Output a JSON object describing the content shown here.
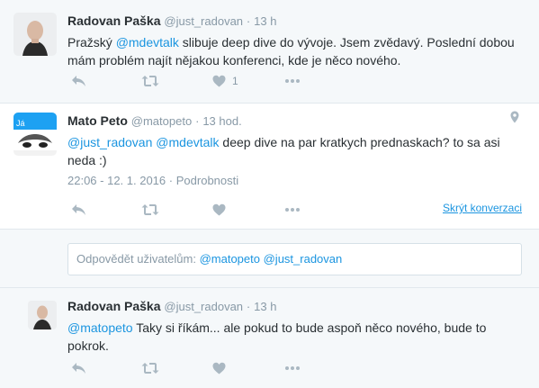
{
  "tweets": [
    {
      "name": "Radovan Paška",
      "handle": "@just_radovan",
      "dot": "·",
      "time": "13 h",
      "text_parts": [
        {
          "text": "Pražský ",
          "mention": false
        },
        {
          "text": "@mdevtalk",
          "mention": true
        },
        {
          "text": " slibuje deep dive do vývoje. Jsem zvědavý. Poslední dobou mám problém najít nějakou konferenci, kde je něco nového.",
          "mention": false
        }
      ],
      "like_count": "1"
    },
    {
      "name": "Mato Peto",
      "handle": "@matopeto",
      "dot": "·",
      "time": "13 hod.",
      "text_parts": [
        {
          "text": "@just_radovan",
          "mention": true
        },
        {
          "text": " ",
          "mention": false
        },
        {
          "text": "@mdevtalk",
          "mention": true
        },
        {
          "text": " deep dive na par kratkych prednaskach? to sa asi neda :)",
          "mention": false
        }
      ],
      "timestamp": "22:06 - 12. 1. 2016",
      "details_label": "Podrobnosti",
      "hide_conversation": "Skrýt konverzaci",
      "avatar_label": "Já"
    },
    {
      "name": "Radovan Paška",
      "handle": "@just_radovan",
      "dot": "·",
      "time": "13 h",
      "text_parts": [
        {
          "text": "@matopeto",
          "mention": true
        },
        {
          "text": " Taky si říkám... ale pokud to bude aspoň něco nového, bude to pokrok.",
          "mention": false
        }
      ]
    }
  ],
  "reply": {
    "prefix": "Odpovědět uživatelům: ",
    "mention1": "@matopeto",
    "mention2": "@just_radovan"
  },
  "icons": {
    "reply": "reply-icon",
    "retweet": "retweet-icon",
    "like": "heart-icon",
    "more": "more-icon",
    "location": "location-pin-icon"
  },
  "colors": {
    "link": "#1b95e0",
    "muted": "#8899a6",
    "icon": "#aab8c2",
    "avatar_accent": "#1da1f2"
  }
}
